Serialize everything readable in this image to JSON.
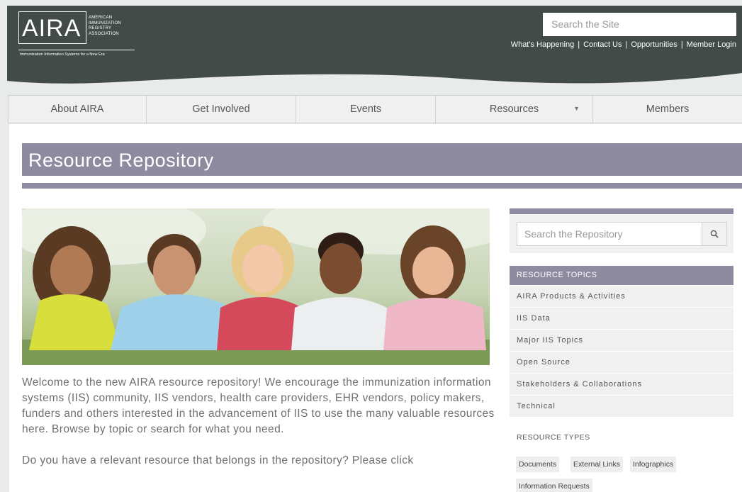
{
  "header": {
    "logo": {
      "wordmark": "AIRA",
      "full_name_lines": [
        "AMERICAN",
        "IMMUNIZATION",
        "REGISTRY",
        "ASSOCIATION"
      ],
      "tagline": "Immunization Information Systems for a New Era"
    },
    "site_search_placeholder": "Search the Site",
    "links": [
      "What's Happening",
      "Contact Us",
      "Opportunities",
      "Member Login"
    ],
    "link_separator": "|"
  },
  "nav": {
    "items": [
      {
        "label": "About AIRA"
      },
      {
        "label": "Get Involved"
      },
      {
        "label": "Events"
      },
      {
        "label": "Resources",
        "has_dropdown": true
      },
      {
        "label": "Members"
      }
    ]
  },
  "page_title": "Resource Repository",
  "intro": {
    "paragraphs": [
      "Welcome to the new AIRA resource repository! We encourage the immunization information systems (IIS) community, IIS vendors, health care providers, EHR vendors, policy makers, funders and others interested in the advancement of IIS to use the many valuable resources here. Browse by topic or search for what you need.",
      "Do you have a relevant resource that belongs in the repository? Please click"
    ]
  },
  "sidebar": {
    "repo_search_placeholder": "Search the Repository",
    "search_icon": "search-icon",
    "topics_header": "RESOURCE TOPICS",
    "topics": [
      "AIRA Products & Activities",
      "IIS Data",
      "Major IIS Topics",
      "Open Source",
      "Stakeholders & Collaborations",
      "Technical"
    ],
    "types_header": "RESOURCE TYPES",
    "types": [
      "Documents",
      "External Links",
      "Infographics",
      "Information Requests"
    ]
  },
  "colors": {
    "header_bg": "#424b47",
    "accent": "#8e8ba1",
    "nav_bg": "#eff0ef",
    "text": "#6f6f6f"
  }
}
